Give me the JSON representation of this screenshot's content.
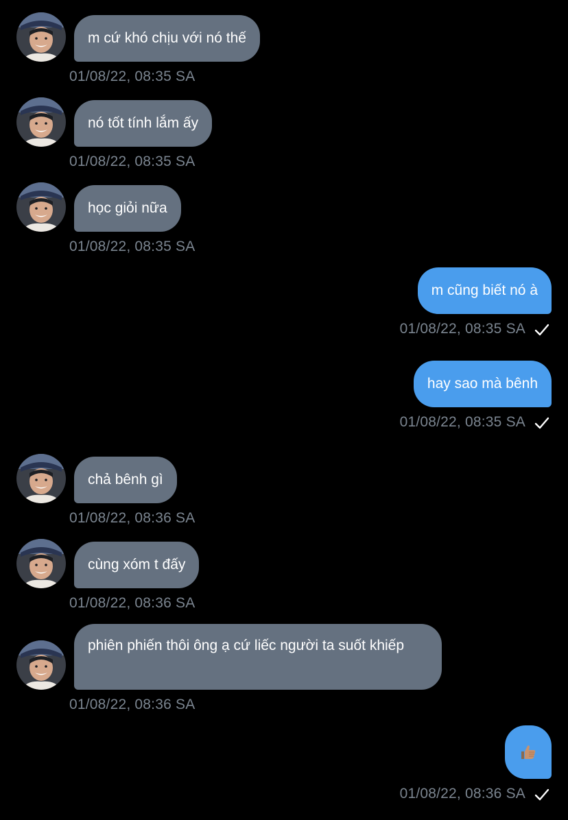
{
  "colors": {
    "background": "#000000",
    "incoming_bubble": "#657180",
    "outgoing_bubble": "#4a9ded",
    "timestamp": "#7b8590",
    "text": "#ffffff"
  },
  "messages": [
    {
      "direction": "in",
      "text": "m cứ khó chịu với nó thế",
      "time": "01/08/22, 08:35 SA"
    },
    {
      "direction": "in",
      "text": "nó tốt tính lắm ấy",
      "time": "01/08/22, 08:35 SA"
    },
    {
      "direction": "in",
      "text": "học giỏi nữa",
      "time": "01/08/22, 08:35 SA"
    },
    {
      "direction": "out",
      "text": "m cũng biết nó à",
      "time": "01/08/22, 08:35 SA",
      "read_icon": "checkmark-icon"
    },
    {
      "direction": "out",
      "text": "hay sao mà bênh",
      "time": "01/08/22, 08:35 SA",
      "read_icon": "checkmark-icon"
    },
    {
      "direction": "in",
      "text": "chả bênh gì",
      "time": "01/08/22, 08:36 SA"
    },
    {
      "direction": "in",
      "text": "cùng xóm t đấy",
      "time": "01/08/22, 08:36 SA"
    },
    {
      "direction": "in",
      "text": "phiên phiến thôi ông ạ cứ liếc người ta suốt khiếp",
      "time": "01/08/22, 08:36 SA"
    },
    {
      "direction": "out",
      "emoji": "thumbs-up-icon",
      "time": "01/08/22, 08:36 SA",
      "read_icon": "checkmark-icon"
    }
  ]
}
